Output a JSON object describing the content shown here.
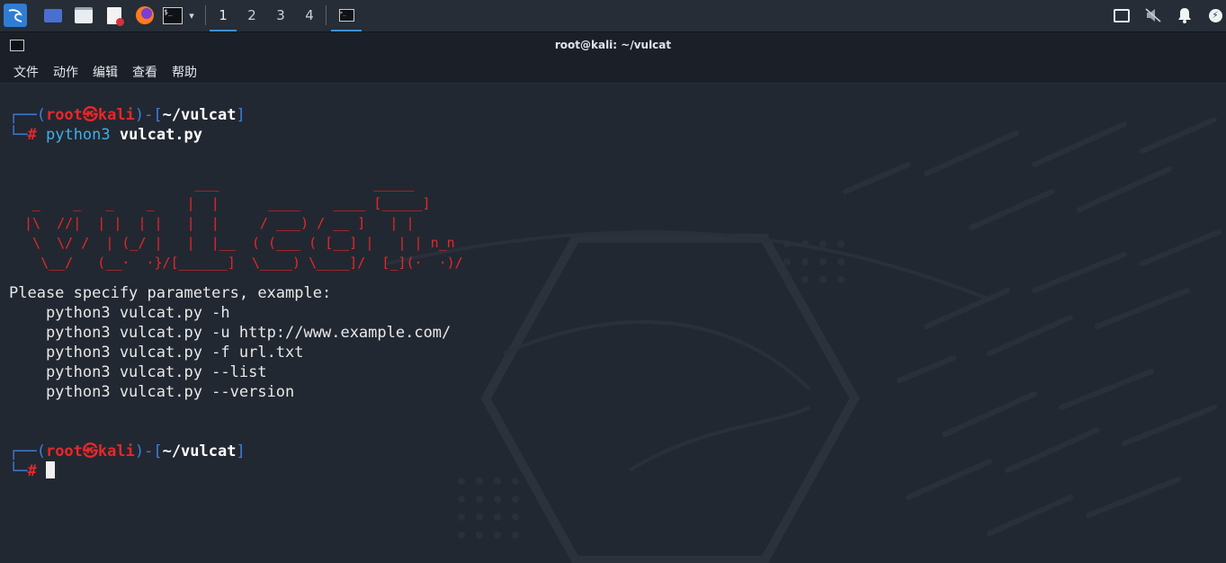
{
  "taskbar": {
    "workspaces": [
      "1",
      "2",
      "3",
      "4"
    ],
    "active_workspace": "1",
    "icons": [
      "kali-menu-icon",
      "show-desktop-icon",
      "file-manager-icon",
      "text-editor-icon",
      "firefox-icon",
      "terminal-icon",
      "chevron-down-icon",
      "terminal-window-icon",
      "display-icon",
      "muted-speaker-icon",
      "bell-icon",
      "power-icon"
    ]
  },
  "window": {
    "title": "root@kali: ~/vulcat",
    "menu": [
      "文件",
      "动作",
      "编辑",
      "查看",
      "帮助"
    ]
  },
  "terminal": {
    "prompt1": {
      "open": "┌──(",
      "user": "root",
      "at": "㉿",
      "host": "kali",
      "mid": ")-[",
      "path": "~/vulcat",
      "close": "]",
      "corner": "└─",
      "hash": "#",
      "cmd": "python3",
      "arg": "vulcat.py"
    },
    "banner": [
      "                      ___                   _____",
      "  _    _   _    _    |  |      ____    ____ [_____]",
      " |\\  //|  | |  | |   |  |     / ___) / __ ]   | |",
      "  \\  \\/ /  | (_/ |   |  |__  ( (___ ( [__] |   | | n_n",
      "   \\__/   (__·  ·}/[______]  \\____) \\____]/  [_](·  ·)/"
    ],
    "output": [
      "Please specify parameters, example:",
      "    python3 vulcat.py -h",
      "    python3 vulcat.py -u http://www.example.com/",
      "    python3 vulcat.py -f url.txt",
      "    python3 vulcat.py --list",
      "    python3 vulcat.py --version"
    ],
    "prompt2": {
      "open": "┌──(",
      "user": "root",
      "at": "㉿",
      "host": "kali",
      "mid": ")-[",
      "path": "~/vulcat",
      "close": "]",
      "corner": "└─",
      "hash": "#"
    }
  },
  "colors": {
    "prompt_frame": "#3d7fe0",
    "prompt_user": "#e8272a",
    "command": "#3db0e8",
    "banner": "#e8272a",
    "terminal_bg": "#222831"
  }
}
